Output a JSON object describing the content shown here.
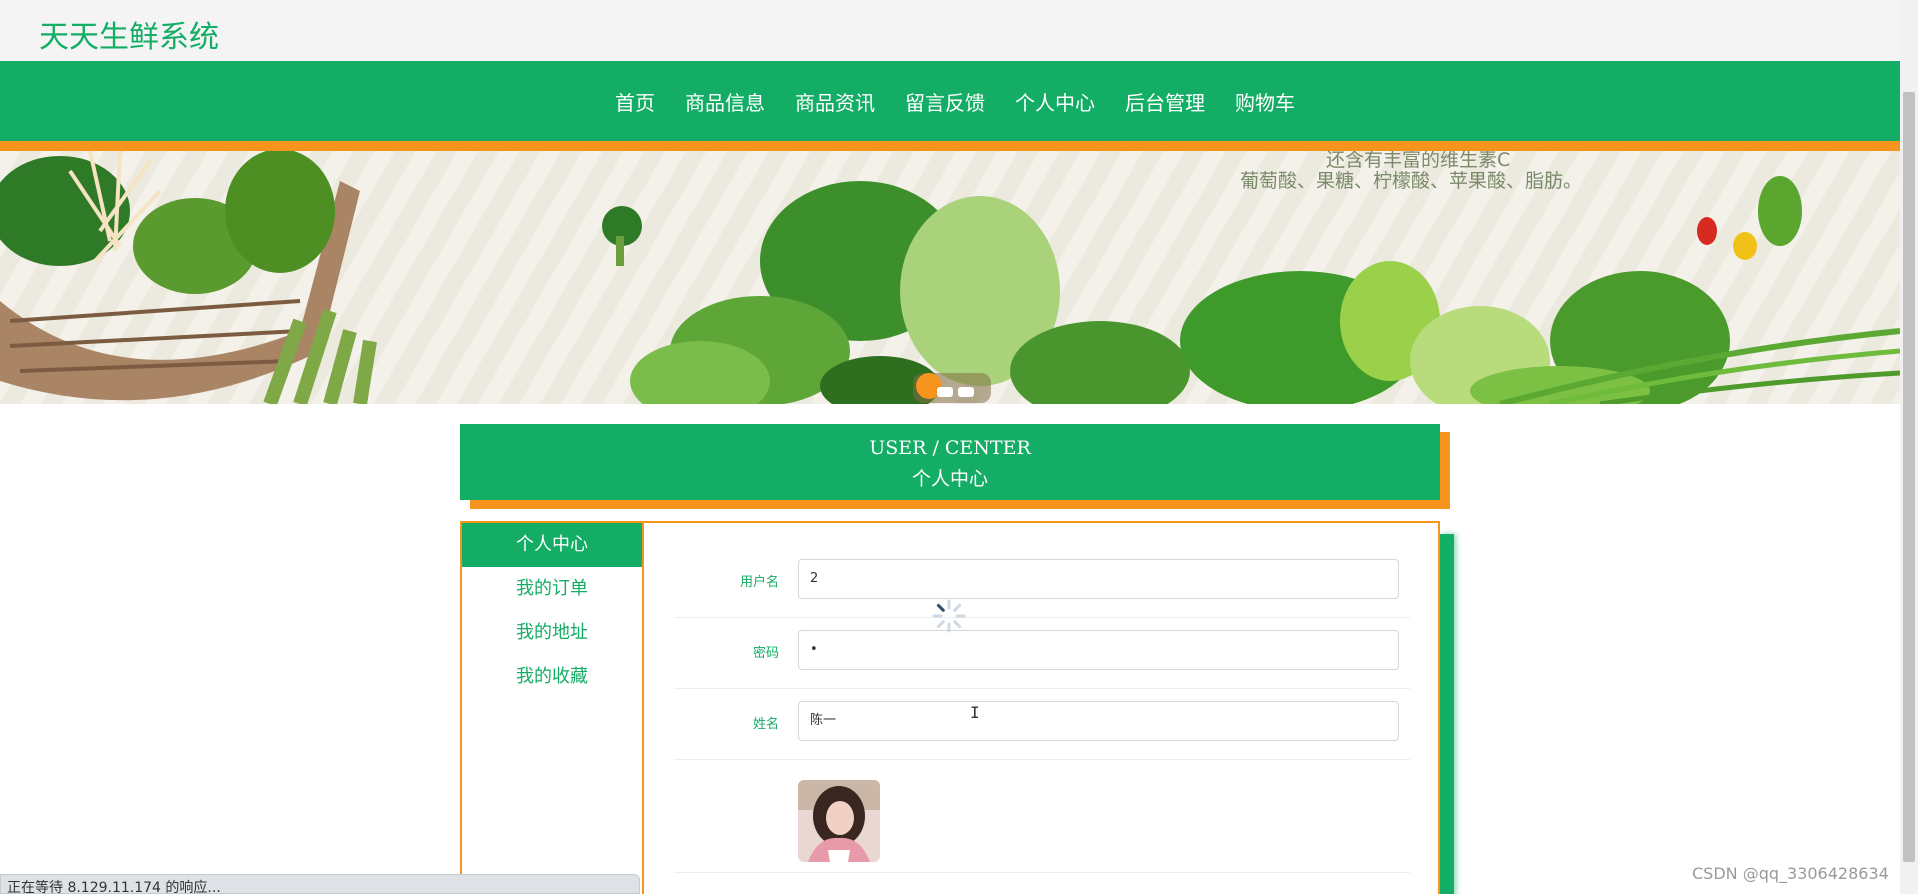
{
  "site": {
    "title": "天天生鲜系统"
  },
  "nav": {
    "items": [
      {
        "label": "首页"
      },
      {
        "label": "商品信息"
      },
      {
        "label": "商品资讯"
      },
      {
        "label": "留言反馈"
      },
      {
        "label": "个人中心"
      },
      {
        "label": "后台管理"
      },
      {
        "label": "购物车"
      }
    ]
  },
  "banner": {
    "line1": "还含有丰富的维生素C",
    "line2": "葡萄酸、果糖、柠檬酸、苹果酸、脂肪。"
  },
  "section": {
    "title_en": "USER / CENTER",
    "title_cn": "个人中心"
  },
  "sidebar": {
    "items": [
      {
        "label": "个人中心"
      },
      {
        "label": "我的订单"
      },
      {
        "label": "我的地址"
      },
      {
        "label": "我的收藏"
      }
    ]
  },
  "form": {
    "username": {
      "label": "用户名",
      "value": "2"
    },
    "password": {
      "label": "密码",
      "value": "•"
    },
    "name": {
      "label": "姓名",
      "value": "陈一"
    }
  },
  "status": {
    "loading_text": "正在等待 8.129.11.174 的响应..."
  },
  "watermark": {
    "text": "CSDN @qq_3306428634"
  },
  "colors": {
    "primary": "#14ad65",
    "accent": "#f7941d"
  }
}
